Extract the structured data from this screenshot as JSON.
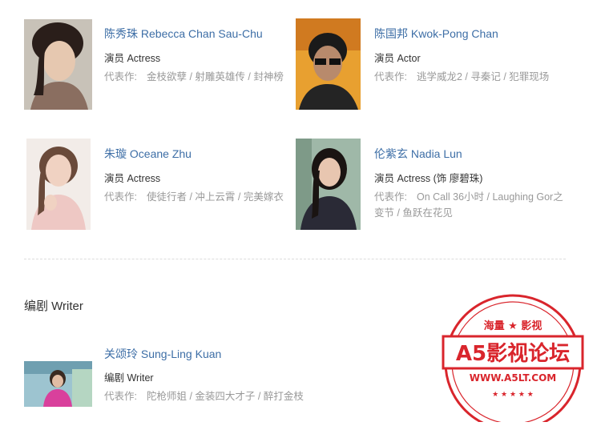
{
  "people": [
    {
      "name": "陈秀珠 Rebecca Chan Sau-Chu",
      "role": "演员 Actress",
      "works_label": "代表作:",
      "works": "金枝欲孽 / 射雕英雄传 / 封神榜"
    },
    {
      "name": "陈国邦 Kwok-Pong Chan",
      "role": "演员 Actor",
      "works_label": "代表作:",
      "works": "逃学威龙2 / 寻秦记 / 犯罪现场"
    },
    {
      "name": "朱璇 Oceane Zhu",
      "role": "演员 Actress",
      "works_label": "代表作:",
      "works": "使徒行者 / 冲上云霄 / 完美嫁衣"
    },
    {
      "name": "伦紫玄 Nadia Lun",
      "role": "演员 Actress (饰 廖碧珠)",
      "works_label": "代表作:",
      "works": "On Call 36小时 / Laughing Gor之变节 / 鱼跃在花见"
    }
  ],
  "writer_section": {
    "title": "编剧 Writer",
    "people": [
      {
        "name": "关颂玲 Sung-Ling Kuan",
        "role": "编剧 Writer",
        "works_label": "代表作:",
        "works": "陀枪师姐 / 金装四大才子 / 醉打金枝"
      }
    ]
  },
  "watermark": {
    "top_text": "海量 ★ 影视",
    "banner": "A5影视论坛",
    "url": "WWW.A5LT.COM",
    "color": "#d9252c"
  }
}
